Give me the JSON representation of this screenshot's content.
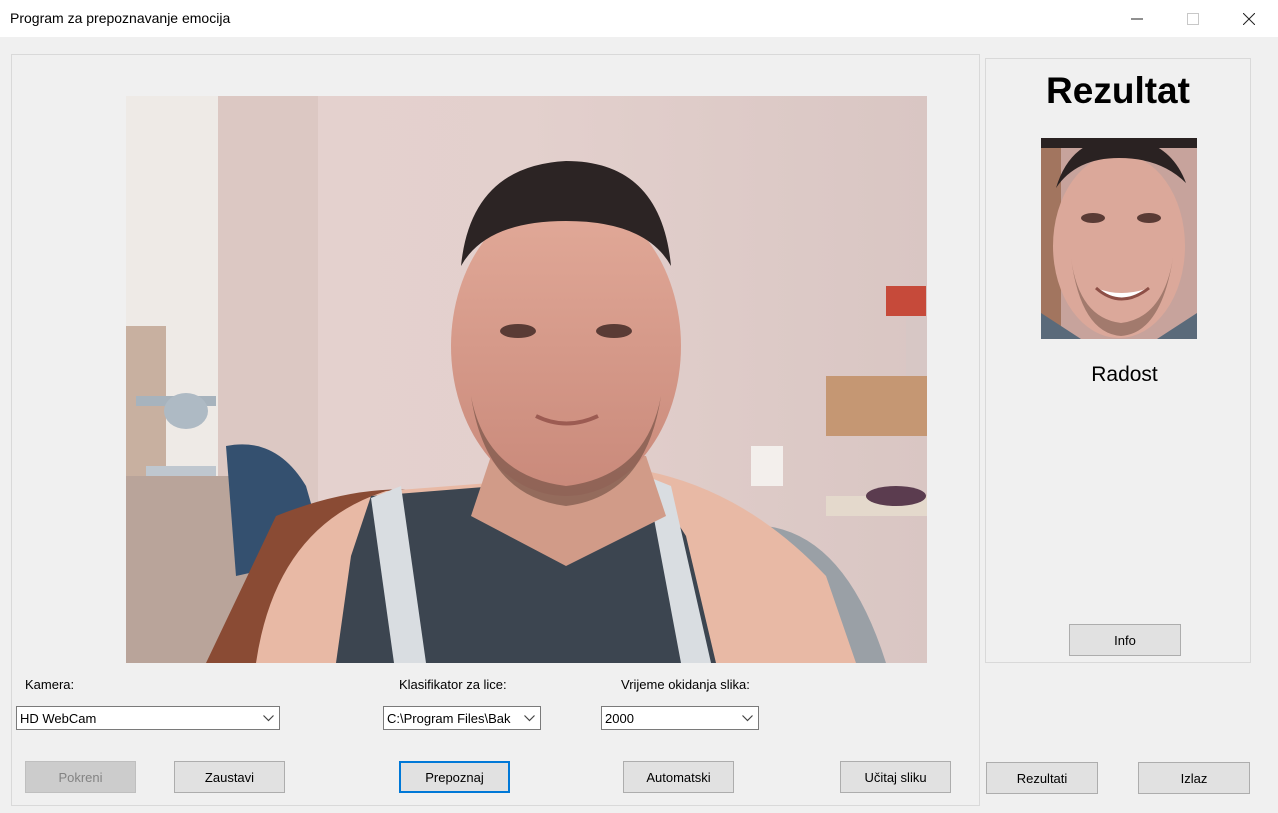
{
  "window": {
    "title": "Program za prepoznavanje emocija"
  },
  "left": {
    "kamera_label": "Kamera:",
    "kamera_value": "HD WebCam",
    "klasifikator_label": "Klasifikator za lice:",
    "klasifikator_value": "C:\\Program Files\\Bak",
    "vrijeme_label": "Vrijeme okidanja slika:",
    "vrijeme_value": "2000",
    "buttons": {
      "pokreni": "Pokreni",
      "zaustavi": "Zaustavi",
      "prepoznaj": "Prepoznaj",
      "automatski": "Automatski",
      "ucitaj": "Učitaj sliku"
    }
  },
  "right": {
    "title": "Rezultat",
    "emotion": "Radost",
    "info": "Info",
    "rezultati": "Rezultati",
    "izlaz": "Izlaz"
  },
  "colors": {
    "accent": "#0078d7"
  }
}
